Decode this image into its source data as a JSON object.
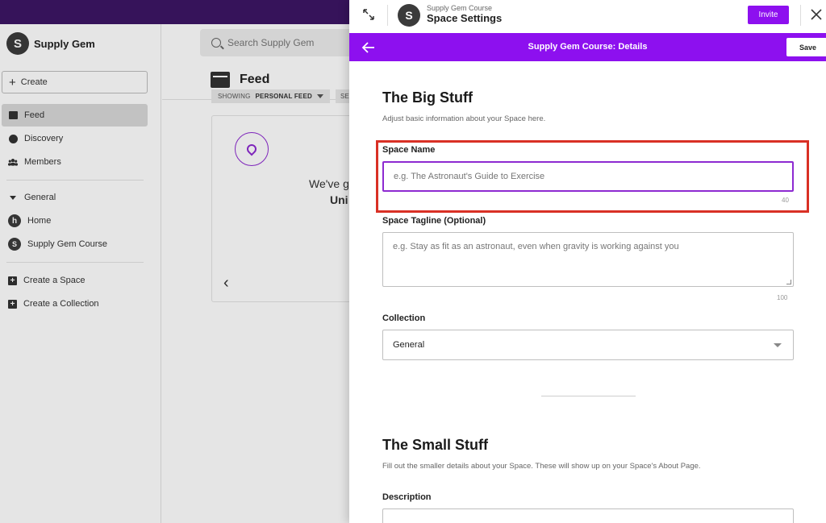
{
  "background_app": {
    "brand": {
      "avatar_letter": "S",
      "name": "Supply Gem"
    },
    "create_label": "Create",
    "nav": [
      {
        "label": "Feed",
        "icon": "feed-icon",
        "active": true
      },
      {
        "label": "Discovery",
        "icon": "compass-icon",
        "active": false
      },
      {
        "label": "Members",
        "icon": "members-icon",
        "active": false
      }
    ],
    "group_label": "General",
    "spaces": [
      {
        "label": "Home",
        "icon_letter": "h"
      },
      {
        "label": "Supply Gem Course",
        "icon_letter": "S"
      }
    ],
    "actions": [
      {
        "label": "Create a Space"
      },
      {
        "label": "Create a Collection"
      }
    ],
    "search_placeholder": "Search Supply Gem",
    "feed_title": "Feed",
    "feed_filter": {
      "prefix": "SHOWING",
      "value": "PERSONAL FEED"
    },
    "feed_filter2": "SE",
    "card_text_1": "We've g",
    "card_text_2": "Uni"
  },
  "panel": {
    "header": {
      "subtitle": "Supply Gem Course",
      "title": "Space Settings",
      "avatar_letter": "S",
      "invite_label": "Invite"
    },
    "subheader": {
      "title": "Supply Gem Course: Details",
      "save_label": "Save"
    },
    "big_stuff": {
      "heading": "The Big Stuff",
      "description": "Adjust basic information about your Space here."
    },
    "space_name": {
      "label": "Space Name",
      "value": "",
      "placeholder": "e.g. The Astronaut's Guide to Exercise",
      "max_chars": "40"
    },
    "tagline": {
      "label": "Space Tagline (Optional)",
      "value": "",
      "placeholder": "e.g. Stay as fit as an astronaut, even when gravity is working against you",
      "max_chars": "100"
    },
    "collection": {
      "label": "Collection",
      "selected": "General"
    },
    "small_stuff": {
      "heading": "The Small Stuff",
      "description": "Fill out the smaller details about your Space. These will show up on your Space's About Page."
    },
    "description_field": {
      "label": "Description"
    }
  },
  "colors": {
    "accent": "#8d10ef",
    "focus_border": "#8d2ad1",
    "highlight_box": "#d93025",
    "top_strip": "#3d1665"
  }
}
